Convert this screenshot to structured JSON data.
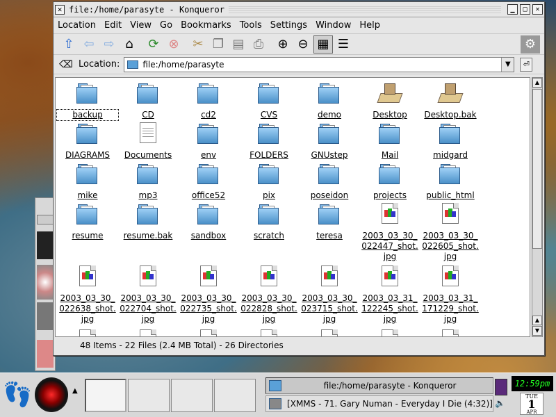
{
  "window": {
    "title": "file:/home/parasyte - Konqueror",
    "menu_button": "✕",
    "min": "▁",
    "max": "□",
    "close": "✕"
  },
  "menubar": [
    "Location",
    "Edit",
    "View",
    "Go",
    "Bookmarks",
    "Tools",
    "Settings",
    "Window",
    "Help"
  ],
  "toolbar": {
    "icons": [
      "up-arrow-icon",
      "back-icon",
      "forward-icon",
      "home-icon",
      "reload-icon",
      "stop-icon",
      "cut-icon",
      "copy-icon",
      "paste-icon",
      "print-icon",
      "zoom-in-icon",
      "zoom-out-icon",
      "icon-view-icon",
      "detailed-view-icon",
      "gear-icon"
    ]
  },
  "location": {
    "label": "Location:",
    "value": "file:/home/parasyte"
  },
  "files": [
    {
      "name": "backup",
      "type": "folder"
    },
    {
      "name": "CD",
      "type": "folder"
    },
    {
      "name": "cd2",
      "type": "folder"
    },
    {
      "name": "CVS",
      "type": "folder"
    },
    {
      "name": "demo",
      "type": "folder"
    },
    {
      "name": "Desktop",
      "type": "desktop"
    },
    {
      "name": "Desktop.bak",
      "type": "desktop"
    },
    {
      "name": "DIAGRAMS",
      "type": "folder"
    },
    {
      "name": "Documents",
      "type": "document"
    },
    {
      "name": "env",
      "type": "folder"
    },
    {
      "name": "FOLDERS",
      "type": "folder"
    },
    {
      "name": "GNUstep",
      "type": "folder"
    },
    {
      "name": "Mail",
      "type": "folder"
    },
    {
      "name": "midgard",
      "type": "folder"
    },
    {
      "name": "mike",
      "type": "folder"
    },
    {
      "name": "mp3",
      "type": "folder"
    },
    {
      "name": "office52",
      "type": "folder"
    },
    {
      "name": "pix",
      "type": "folder"
    },
    {
      "name": "poseidon",
      "type": "folder"
    },
    {
      "name": "projects",
      "type": "folder"
    },
    {
      "name": "public_html",
      "type": "folder"
    },
    {
      "name": "resume",
      "type": "folder"
    },
    {
      "name": "resume.bak",
      "type": "folder"
    },
    {
      "name": "sandbox",
      "type": "folder"
    },
    {
      "name": "scratch",
      "type": "folder"
    },
    {
      "name": "teresa",
      "type": "folder"
    },
    {
      "name": "2003_03_30_ 022447_shot. jpg",
      "type": "image"
    },
    {
      "name": "2003_03_30_ 022605_shot. jpg",
      "type": "image"
    },
    {
      "name": "2003_03_30_ 022638_shot. jpg",
      "type": "image"
    },
    {
      "name": "2003_03_30_ 022704_shot. jpg",
      "type": "image"
    },
    {
      "name": "2003_03_30_ 022735_shot. jpg",
      "type": "image"
    },
    {
      "name": "2003_03_30_ 022828_shot. jpg",
      "type": "image"
    },
    {
      "name": "2003_03_30_ 023715_shot. jpg",
      "type": "image"
    },
    {
      "name": "2003_03_31_ 122245_shot. jpg",
      "type": "image"
    },
    {
      "name": "2003_03_31_ 171229_shot. jpg",
      "type": "image"
    }
  ],
  "status": "48 Items - 22 Files (2.4 MB Total) - 26 Directories",
  "taskbar": {
    "tasks": [
      {
        "label": "file:/home/parasyte - Konqueror",
        "active": true
      },
      {
        "label": "[XMMS - 71. Gary Numan - Everyday I Die (4:32)]",
        "active": false
      }
    ],
    "clock": "12:59pm",
    "date_dow": "TUE",
    "date_day": "1",
    "date_month": "APR"
  },
  "colors": {
    "window_bg": "#e6e6e6",
    "folder_blue": "#5aa0d8",
    "clock_green": "#22ff22"
  }
}
